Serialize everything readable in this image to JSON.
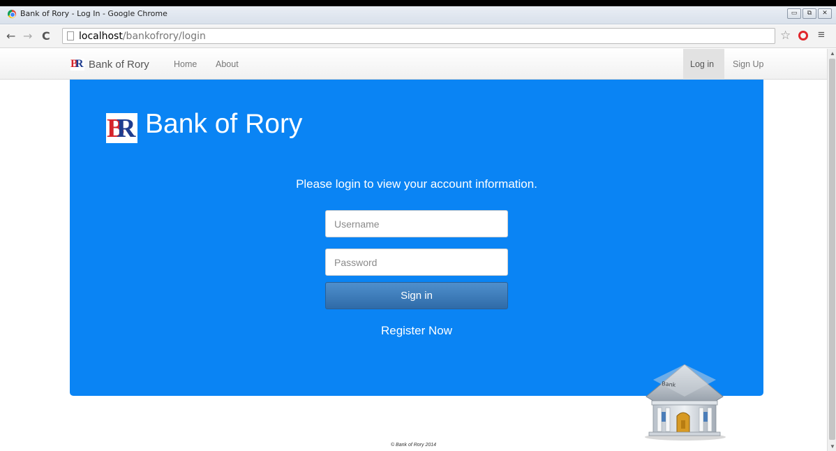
{
  "window": {
    "title": "Bank of Rory - Log In - Google Chrome",
    "controls": [
      "▭",
      "⧉",
      "✕"
    ]
  },
  "browser": {
    "url_host": "localhost",
    "url_path": "/bankofrory/login",
    "back_glyph": "←",
    "forward_glyph": "→",
    "reload_glyph": "C",
    "star_glyph": "☆",
    "menu_glyph": "≡"
  },
  "navbar": {
    "brand_logo": "BR",
    "brand": "Bank of Rory",
    "links": [
      "Home",
      "About"
    ],
    "login": "Log in",
    "signup": "Sign Up"
  },
  "hero": {
    "logo": "BR",
    "title": "Bank of Rory",
    "lead": "Please login to view your account information."
  },
  "form": {
    "username_placeholder": "Username",
    "password_placeholder": "Password",
    "signin": "Sign in",
    "register": "Register Now"
  },
  "bank_sign": "Bank",
  "footer": "© Bank of Rory 2014",
  "colors": {
    "hero_bg": "#0a84f4",
    "button": "#3a78b8",
    "logo_b": "#d6242b",
    "logo_r": "#1f3d8f"
  },
  "icons": [
    "chrome-favicon",
    "back-arrow-icon",
    "forward-arrow-icon",
    "reload-icon",
    "page-icon",
    "star-icon",
    "opera-icon",
    "menu-icon",
    "bank-building-icon"
  ]
}
